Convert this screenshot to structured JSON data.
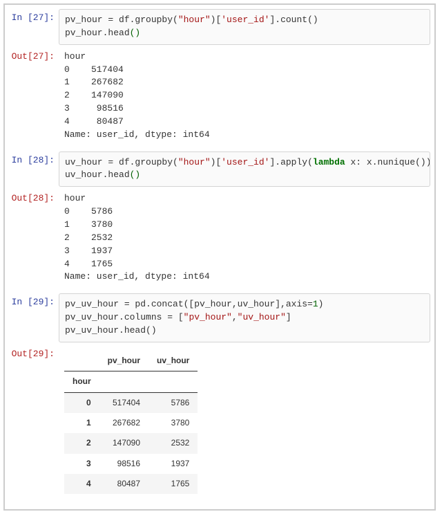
{
  "cells": [
    {
      "in_prompt": "In [27]:",
      "code": "",
      "out_prompt": "Out[27]:",
      "out_text": "hour\n0    517404\n1    267682\n2    147090\n3     98516\n4     80487\nName: user_id, dtype: int64"
    },
    {
      "in_prompt": "In [28]:",
      "code": "",
      "out_prompt": "Out[28]:",
      "out_text": "hour\n0    5786\n1    3780\n2    2532\n3    1937\n4    1765\nName: user_id, dtype: int64"
    },
    {
      "in_prompt": "In [29]:",
      "code": "",
      "out_prompt": "Out[29]:"
    }
  ],
  "code27": {
    "p1": "pv_hour = df.groupby(",
    "s1": "\"hour\"",
    "p2": ")[",
    "s2": "'user_id'",
    "p3": "].count()",
    "l2a": "pv_hour.head",
    "l2b": "()"
  },
  "code28": {
    "p1": "uv_hour = df.groupby(",
    "s1": "\"hour\"",
    "p2": ")[",
    "s2": "'user_id'",
    "p3": "].apply(",
    "kw": "lambda",
    "p4": " x: x.nunique())",
    "l2a": "uv_hour.head",
    "l2b": "()"
  },
  "code29": {
    "l1a": "pv_uv_hour = pd.concat([pv_hour,uv_hour],axis=",
    "n1": "1",
    "l1b": ")",
    "l2a": "pv_uv_hour.columns = [",
    "s1": "\"pv_hour\"",
    "l2b": ",",
    "s2": "\"uv_hour\"",
    "l2c": "]",
    "l3": "pv_uv_hour.head()"
  },
  "df": {
    "index_name": "hour",
    "columns": [
      "pv_hour",
      "uv_hour"
    ],
    "index": [
      "0",
      "1",
      "2",
      "3",
      "4"
    ],
    "data": [
      [
        "517404",
        "5786"
      ],
      [
        "267682",
        "3780"
      ],
      [
        "147090",
        "2532"
      ],
      [
        "98516",
        "1937"
      ],
      [
        "80487",
        "1765"
      ]
    ]
  },
  "chart_data": {
    "type": "table",
    "title": "",
    "tables": [
      {
        "name": "pv_hour (cell 27)",
        "index": "hour",
        "columns": [
          "user_id (count)"
        ],
        "rows": [
          [
            0,
            517404
          ],
          [
            1,
            267682
          ],
          [
            2,
            147090
          ],
          [
            3,
            98516
          ],
          [
            4,
            80487
          ]
        ]
      },
      {
        "name": "uv_hour (cell 28)",
        "index": "hour",
        "columns": [
          "user_id (nunique)"
        ],
        "rows": [
          [
            0,
            5786
          ],
          [
            1,
            3780
          ],
          [
            2,
            2532
          ],
          [
            3,
            1937
          ],
          [
            4,
            1765
          ]
        ]
      },
      {
        "name": "pv_uv_hour (cell 29)",
        "index": "hour",
        "columns": [
          "pv_hour",
          "uv_hour"
        ],
        "rows": [
          [
            0,
            517404,
            5786
          ],
          [
            1,
            267682,
            3780
          ],
          [
            2,
            147090,
            2532
          ],
          [
            3,
            98516,
            1937
          ],
          [
            4,
            80487,
            1765
          ]
        ]
      }
    ]
  }
}
